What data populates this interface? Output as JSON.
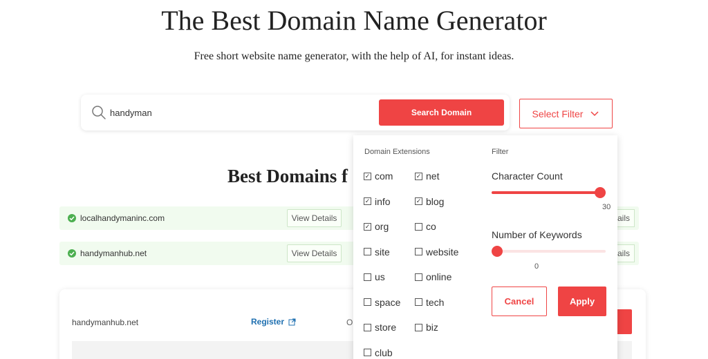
{
  "hero": {
    "title": "The Best Domain Name Generator",
    "subtitle": "Free short website name generator, with the help of AI, for instant ideas."
  },
  "search": {
    "value": "handyman",
    "icon": "search-icon",
    "button_label": "Search Domain"
  },
  "filter_button": {
    "label": "Select Filter",
    "icon": "chevron-down-icon"
  },
  "section": {
    "title": "Best Domains f"
  },
  "results": [
    {
      "domain": "localhandymaninc.com",
      "details_label": "View Details",
      "details_right": "ails",
      "status_icon": "check-circle-icon"
    },
    {
      "domain": "handymanhub.net",
      "details_label": "View Details",
      "details_right": "ails",
      "status_icon": "check-circle-icon"
    }
  ],
  "detail_card": {
    "domain": "handymanhub.net",
    "register_label": "Register",
    "register_icon": "external-link-icon",
    "partial_text": "O"
  },
  "filter_panel": {
    "extensions_heading": "Domain Extensions",
    "filter_heading": "Filter",
    "extensions": [
      {
        "label": "com",
        "checked": true
      },
      {
        "label": "net",
        "checked": true
      },
      {
        "label": "info",
        "checked": true
      },
      {
        "label": "blog",
        "checked": true
      },
      {
        "label": "org",
        "checked": true
      },
      {
        "label": "co",
        "checked": false
      },
      {
        "label": "site",
        "checked": false
      },
      {
        "label": "website",
        "checked": false
      },
      {
        "label": "us",
        "checked": false
      },
      {
        "label": "online",
        "checked": false
      },
      {
        "label": "space",
        "checked": false
      },
      {
        "label": "tech",
        "checked": false
      },
      {
        "label": "store",
        "checked": false
      },
      {
        "label": "biz",
        "checked": false
      },
      {
        "label": "club",
        "checked": false
      }
    ],
    "character_count": {
      "label": "Character Count",
      "value": "30",
      "fraction": 1.0
    },
    "keywords": {
      "label": "Number of Keywords",
      "value": "0",
      "fraction": 0.0
    },
    "cancel_label": "Cancel",
    "apply_label": "Apply"
  },
  "colors": {
    "accent": "#ef4444",
    "success_bg": "#f1fbef",
    "success_icon": "#4caf50",
    "link": "#1e6fb0"
  }
}
